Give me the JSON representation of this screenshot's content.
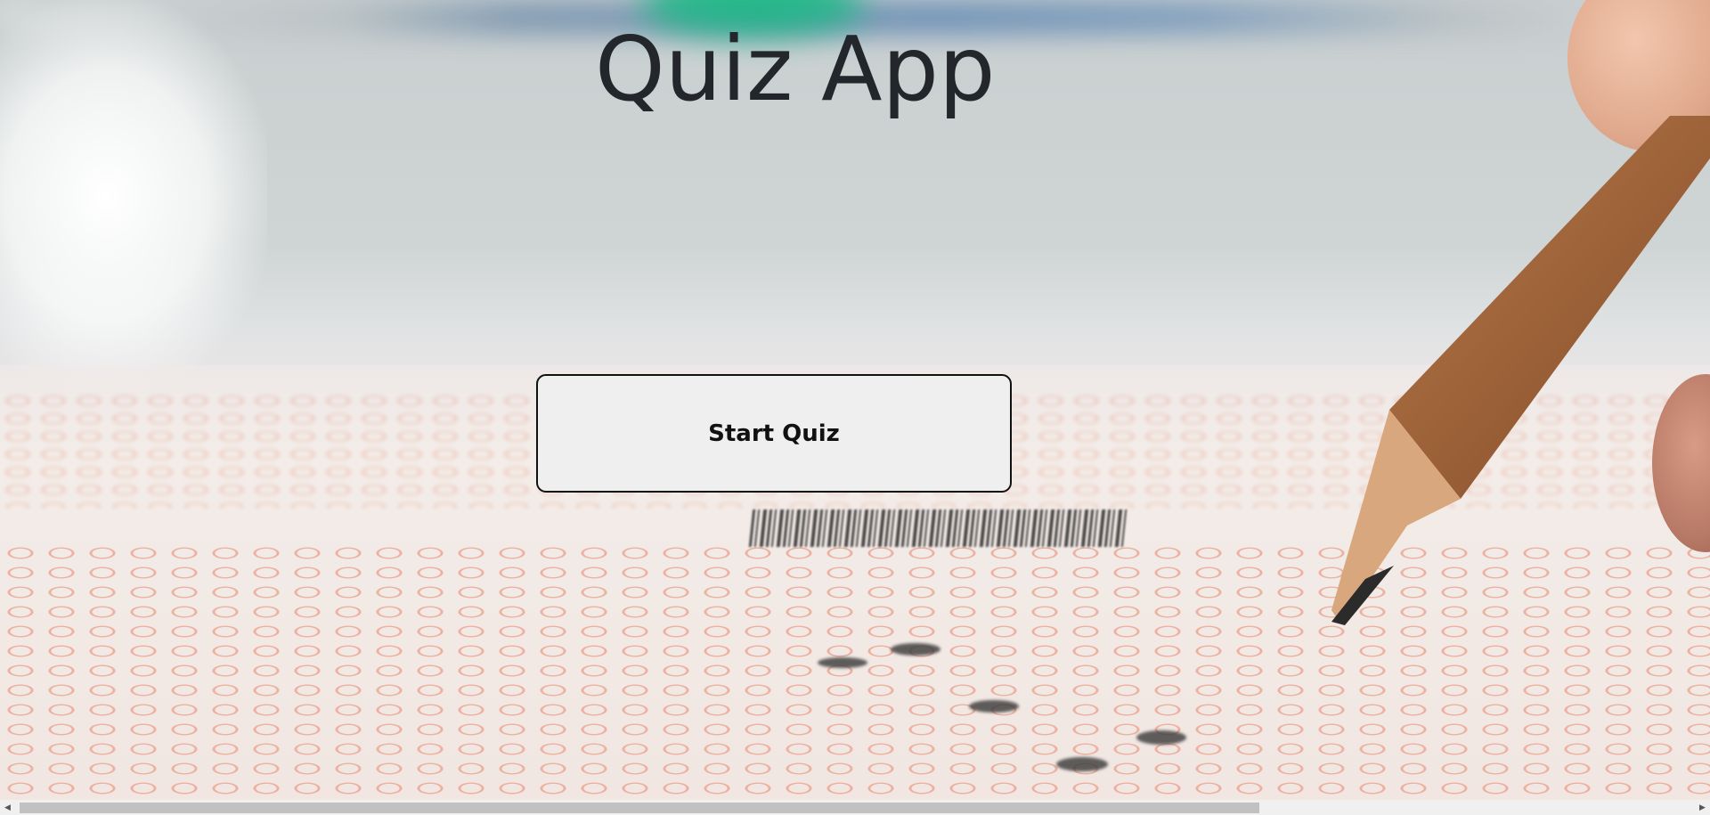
{
  "app": {
    "title": "Quiz App"
  },
  "actions": {
    "start_label": "Start Quiz"
  },
  "scrollbar": {
    "left_arrow": "◀",
    "right_arrow": "▶",
    "orientation": "horizontal"
  },
  "colors": {
    "title_text": "#23262a",
    "button_bg": "#efefef",
    "button_border": "#111111"
  }
}
